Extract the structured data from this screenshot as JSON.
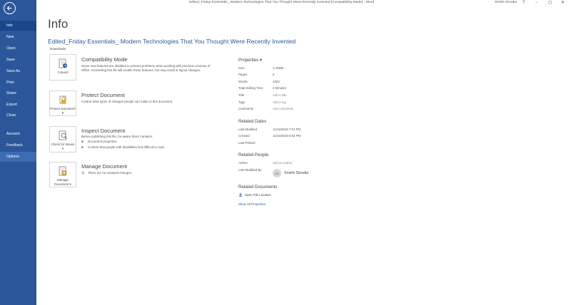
{
  "window": {
    "title": "Edited_Friday Essentials_ Modern Technologies That You Thought Were Recently Invented [Compatibility Mode]  -  Word",
    "user": "Srishti Sisodia",
    "help": "?",
    "minimize": "−",
    "restore": "▢",
    "close": "✕"
  },
  "sidebar": {
    "items": [
      {
        "label": "Info"
      },
      {
        "label": "New"
      },
      {
        "label": "Open"
      },
      {
        "label": "Save"
      },
      {
        "label": "Save As"
      },
      {
        "label": "Print"
      },
      {
        "label": "Share"
      },
      {
        "label": "Export"
      },
      {
        "label": "Close"
      },
      {
        "label": "Account"
      },
      {
        "label": "Feedback"
      },
      {
        "label": "Options"
      }
    ]
  },
  "main": {
    "page_title": "Info",
    "file_title": "Edited_Friday Essentials_ Modern Technologies That You Thought Were Recently Invented",
    "file_path": "Downloads",
    "sections": [
      {
        "card_label": "Convert",
        "title": "Compatibility Mode",
        "description": "Some new features are disabled to prevent problems when working with previous versions of Office. Converting this file will enable these features, but may result in layout changes."
      },
      {
        "card_label": "Protect Document ▾",
        "title": "Protect Document",
        "description": "Control what types of changes people can make to this document."
      },
      {
        "card_label": "Check for Issues ▾",
        "title": "Inspect Document",
        "description": "Before publishing this file, be aware that it contains:",
        "bullets": [
          "Document properties",
          "Content that people with disabilities find difficult to read"
        ]
      },
      {
        "card_label": "Manage Document ▾",
        "title": "Manage Document",
        "description": "There are no unsaved changes."
      }
    ]
  },
  "properties": {
    "heading": "Properties ▾",
    "rows": [
      {
        "label": "Size",
        "value": "1.75MB"
      },
      {
        "label": "Pages",
        "value": "6"
      },
      {
        "label": "Words",
        "value": "1022"
      },
      {
        "label": "Total Editing Time",
        "value": "2 Minutes"
      },
      {
        "label": "Title",
        "value": "Add a title"
      },
      {
        "label": "Tags",
        "value": "Add a tag"
      },
      {
        "label": "Comments",
        "value": "Add comments"
      }
    ],
    "related_dates": {
      "heading": "Related Dates",
      "rows": [
        {
          "label": "Last Modified",
          "value": "11/16/2018 7:01 PM"
        },
        {
          "label": "Created",
          "value": "11/16/2018 6:52 PM"
        },
        {
          "label": "Last Printed",
          "value": ""
        }
      ]
    },
    "related_people": {
      "heading": "Related People",
      "author_label": "Author",
      "author_value": "Add an author",
      "modified_by_label": "Last Modified By",
      "avatar_initials": "SS",
      "modified_by_name": "Srishti Sisodia"
    },
    "related_documents": {
      "heading": "Related Documents",
      "open_location": "Open File Location",
      "show_all": "Show All Properties"
    }
  }
}
